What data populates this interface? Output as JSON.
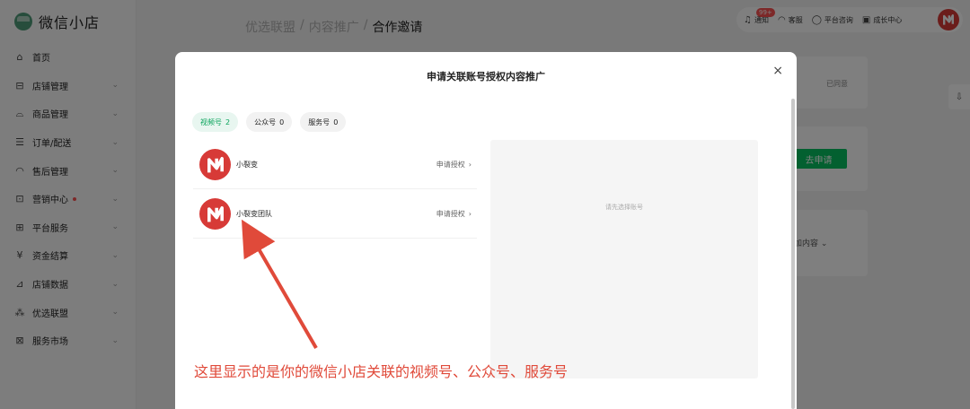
{
  "app": {
    "name": "微信小店"
  },
  "sidebar": {
    "items": [
      {
        "label": "首页",
        "icon": "home-icon",
        "glyph": "⌂",
        "chevron": false
      },
      {
        "label": "店铺管理",
        "icon": "store-icon",
        "glyph": "⊟",
        "chevron": true
      },
      {
        "label": "商品管理",
        "icon": "bag-icon",
        "glyph": "⌓",
        "chevron": true
      },
      {
        "label": "订单/配送",
        "icon": "order-icon",
        "glyph": "☰",
        "chevron": true
      },
      {
        "label": "售后管理",
        "icon": "headset-icon",
        "glyph": "◠",
        "chevron": true
      },
      {
        "label": "营销中心",
        "icon": "marketing-icon",
        "glyph": "⊡",
        "chevron": true,
        "dot": true
      },
      {
        "label": "平台服务",
        "icon": "platform-icon",
        "glyph": "⊞",
        "chevron": true
      },
      {
        "label": "资金结算",
        "icon": "yuan-icon",
        "glyph": "¥",
        "chevron": true
      },
      {
        "label": "店铺数据",
        "icon": "chart-icon",
        "glyph": "⊿",
        "chevron": true
      },
      {
        "label": "优选联盟",
        "icon": "network-icon",
        "glyph": "⁂",
        "chevron": true
      },
      {
        "label": "服务市场",
        "icon": "grid-icon",
        "glyph": "⊠",
        "chevron": true
      }
    ]
  },
  "breadcrumb": {
    "items": [
      "优选联盟",
      "内容推广",
      "合作邀请"
    ],
    "separator": "/"
  },
  "topbar": {
    "notice_label": "通知",
    "notice_badge": "99+",
    "service_label": "客服",
    "consult_label": "平台咨询",
    "growth_label": "成长中心"
  },
  "background": {
    "agreed_label": "已同意",
    "apply_label": "去申请",
    "content_dropdown_label": "加内容"
  },
  "modal": {
    "title": "申请关联账号授权内容推广",
    "close_glyph": "×",
    "tabs": [
      {
        "label": "视频号",
        "count": "2",
        "active": true
      },
      {
        "label": "公众号",
        "count": "0",
        "active": false
      },
      {
        "label": "服务号",
        "count": "0",
        "active": false
      }
    ],
    "accounts": [
      {
        "name": "小裂变",
        "action": "申请授权"
      },
      {
        "name": "小裂变团队",
        "action": "申请授权"
      }
    ],
    "preview_hint": "请先选择账号"
  },
  "annotation": {
    "text": "这里显示的是你的微信小店关联的视频号、公众号、服务号",
    "color": "#e04a3a"
  },
  "colors": {
    "brand_green": "#07c160",
    "accent_red": "#d73a37",
    "badge_red": "#fa5151"
  }
}
